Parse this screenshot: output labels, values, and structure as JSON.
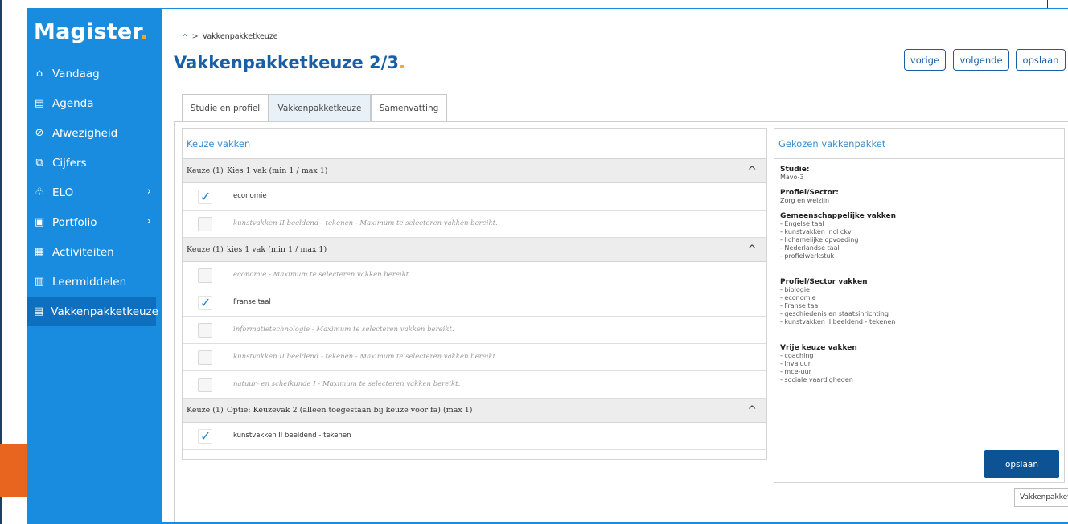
{
  "app": {
    "logo_text": "Magister",
    "logo_dot": "."
  },
  "sidebar": {
    "items": [
      {
        "label": "Vandaag",
        "icon": "home-icon",
        "glyph": "⌂"
      },
      {
        "label": "Agenda",
        "icon": "calendar-icon",
        "glyph": "▤"
      },
      {
        "label": "Afwezigheid",
        "icon": "check-circle-icon",
        "glyph": "⊘"
      },
      {
        "label": "Cijfers",
        "icon": "grades-icon",
        "glyph": "⧉"
      },
      {
        "label": "ELO",
        "icon": "elo-icon",
        "glyph": "♧",
        "chevron": "›"
      },
      {
        "label": "Portfolio",
        "icon": "portfolio-icon",
        "glyph": "▣",
        "chevron": "›"
      },
      {
        "label": "Activiteiten",
        "icon": "activities-icon",
        "glyph": "▦"
      },
      {
        "label": "Leermiddelen",
        "icon": "books-icon",
        "glyph": "▥"
      },
      {
        "label": "Vakkenpakketkeuze",
        "icon": "package-icon",
        "glyph": "▤",
        "active": true
      }
    ]
  },
  "header": {
    "breadcrumb": "Vakkenpakketkeuze",
    "title": "Vakkenpakketkeuze 2/3",
    "title_dot": ".",
    "buttons": {
      "prev": "vorige",
      "next": "volgende",
      "save": "opslaan"
    }
  },
  "tabs": [
    "Studie en profiel",
    "Vakkenpakketkeuze",
    "Samenvatting"
  ],
  "left_panel": {
    "title": "Keuze vakken",
    "groups": [
      {
        "keuze": "Keuze (1)",
        "title": "Kies 1 vak (min 1 / max 1)",
        "caret": "^",
        "rows": [
          {
            "label": "economie",
            "checked": true,
            "disabled": false
          },
          {
            "label": "kunstvakken II beeldend - tekenen - Maximum te selecteren vakken bereikt.",
            "checked": false,
            "disabled": true
          }
        ]
      },
      {
        "keuze": "Keuze (1)",
        "title": "kies 1 vak (min 1 / max 1)",
        "caret": "^",
        "rows": [
          {
            "label": "economie - Maximum te selecteren vakken bereikt.",
            "checked": false,
            "disabled": true
          },
          {
            "label": "Franse taal",
            "checked": true,
            "disabled": false
          },
          {
            "label": "informatietechnologie - Maximum te selecteren vakken bereikt.",
            "checked": false,
            "disabled": true
          },
          {
            "label": "kunstvakken II beeldend - tekenen - Maximum te selecteren vakken bereikt.",
            "checked": false,
            "disabled": true
          },
          {
            "label": "natuur- en scheikunde I - Maximum te selecteren vakken bereikt.",
            "checked": false,
            "disabled": true
          }
        ]
      },
      {
        "keuze": "Keuze (1)",
        "title": "Optie: Keuzevak 2 (alleen toegestaan bij keuze voor fa) (max 1)",
        "caret": "^",
        "rows": [
          {
            "label": "kunstvakken II beeldend - tekenen",
            "checked": true,
            "disabled": false
          }
        ]
      }
    ]
  },
  "right_panel": {
    "title": "Gekozen vakkenpakket",
    "studie_label": "Studie:",
    "studie_value": "Mavo-3",
    "profiel_label": "Profiel/Sector:",
    "profiel_value": "Zorg en welzijn",
    "gemeenschappelijk_label": "Gemeenschappelijke vakken",
    "gemeenschappelijk": [
      "- Engelse taal",
      "- kunstvakken incl ckv",
      "- lichamelijke opvoeding",
      "- Nederlandse taal",
      "- profielwerkstuk"
    ],
    "sector_vakken_label": "Profiel/Sector vakken",
    "sector_vakken": [
      "- biologie",
      "- economie",
      "- Franse taal",
      "- geschiedenis en staatsinrichting",
      "- kunstvakken II beeldend - tekenen"
    ],
    "vrije_label": "Vrije keuze vakken",
    "vrije": [
      "- coaching",
      "- invaluur",
      "- mce-uur",
      "- sociale vaardigheden"
    ],
    "save_label": "opslaan"
  },
  "tooltip": "Vakkenpakketkeuze"
}
